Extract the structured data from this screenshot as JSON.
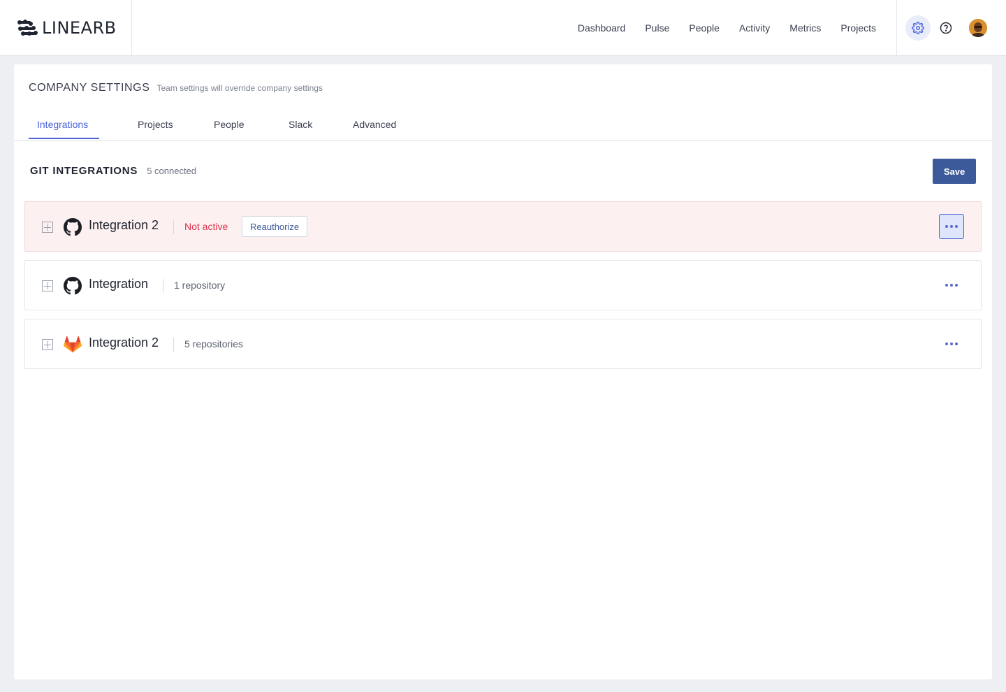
{
  "app": {
    "logo_text": "LINEARB",
    "logo_icon": "linearb-logo-icon"
  },
  "nav": {
    "items": [
      "Dashboard",
      "Pulse",
      "People",
      "Activity",
      "Metrics",
      "Projects"
    ]
  },
  "header_icons": {
    "settings": "gear-icon",
    "help": "help-icon",
    "avatar": "user-avatar"
  },
  "page": {
    "title": "COMPANY SETTINGS",
    "subtitle": "Team settings will override company settings"
  },
  "tabs": [
    {
      "label": "Integrations",
      "active": true
    },
    {
      "label": "Projects",
      "active": false
    },
    {
      "label": "People",
      "active": false
    },
    {
      "label": "Slack",
      "active": false
    },
    {
      "label": "Advanced",
      "active": false
    }
  ],
  "section": {
    "title": "GIT INTEGRATIONS",
    "count": "5 connected",
    "save_label": "Save"
  },
  "integrations": [
    {
      "name": "Integration 2",
      "provider": "github",
      "status": "Not active",
      "action": "Reauthorize",
      "error": true
    },
    {
      "name": "Integration",
      "provider": "github",
      "meta": "1 repository",
      "error": false
    },
    {
      "name": "Integration 2",
      "provider": "gitlab",
      "meta": "5 repositories",
      "error": false
    }
  ],
  "colors": {
    "accent": "#4b63d8",
    "primary_button": "#3c5a99",
    "error_text": "#e0334f",
    "error_bg": "#fdf0f1"
  }
}
